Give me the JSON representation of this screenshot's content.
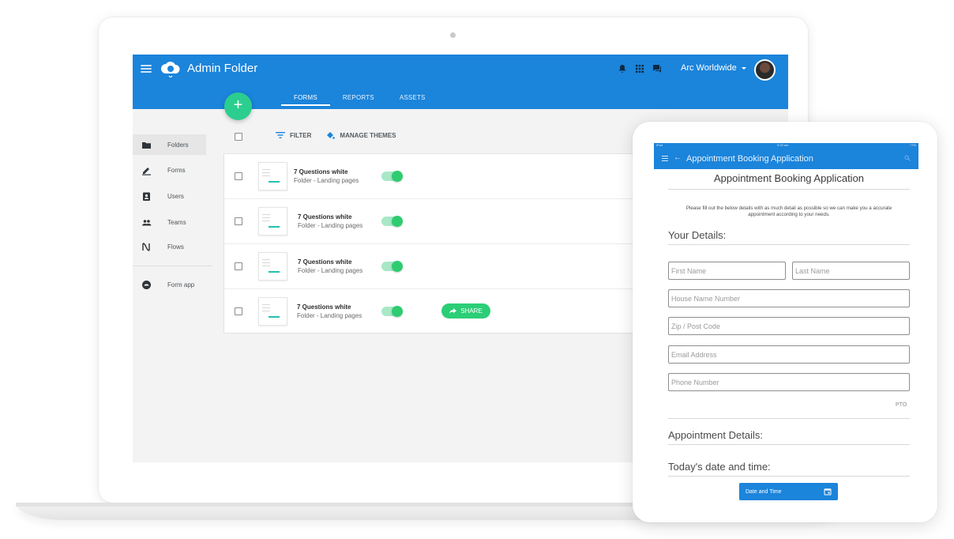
{
  "laptop": {
    "header": {
      "title": "Admin Folder",
      "account_name": "Arc Worldwide",
      "tabs": [
        {
          "label": "FORMS",
          "active": true
        },
        {
          "label": "REPORTS",
          "active": false
        },
        {
          "label": "ASSETS",
          "active": false
        }
      ],
      "fab_label": "+"
    },
    "sidebar": {
      "items": [
        {
          "label": "Folders",
          "icon": "folder-icon",
          "active": true
        },
        {
          "label": "Forms",
          "icon": "edit-icon",
          "active": false
        },
        {
          "label": "Users",
          "icon": "user-badge-icon",
          "active": false
        },
        {
          "label": "Teams",
          "icon": "people-icon",
          "active": false
        },
        {
          "label": "Flows",
          "icon": "flows-icon",
          "active": false
        }
      ],
      "secondary": [
        {
          "label": "Form app",
          "icon": "form-app-icon"
        }
      ]
    },
    "toolbar": {
      "filter_label": "FILTER",
      "themes_label": "MANAGE THEMES"
    },
    "rows": [
      {
        "title": "7 Questions white",
        "subtitle": "Folder - Landing pages",
        "enabled": true,
        "share": null
      },
      {
        "title": "7 Questions white",
        "subtitle": "Folder - Landing pages",
        "enabled": true,
        "share": null
      },
      {
        "title": "7 Questions white",
        "subtitle": "Folder - Landing pages",
        "enabled": true,
        "share": null
      },
      {
        "title": "7 Questions white",
        "subtitle": "Folder - Landing pages",
        "enabled": true,
        "share": "SHARE"
      }
    ]
  },
  "tablet": {
    "status": {
      "left": "iPad",
      "time": "9:29 am",
      "battery": "77%"
    },
    "appbar_title": "Appointment Booking Application",
    "heading": "Appointment Booking Application",
    "intro": "Please fill out the below details with as much detail as possible so we can make you a accurate appointment according to your needs.",
    "your_details": "Your Details:",
    "fields": {
      "first_name": "First Name",
      "last_name": "Last Name",
      "house": "House Name Number",
      "zip": "Zip / Post Code",
      "email": "Email Address",
      "phone": "Phone Number"
    },
    "pto": "PTO",
    "appointment_details": "Appointment Details:",
    "todays_date": "Today's date and time:",
    "date_button": "Date and Time"
  },
  "colors": {
    "primary": "#1b84db",
    "accent_green": "#2bce8e",
    "toggle_green": "#2ecc71",
    "background": "#f3f3f3"
  }
}
